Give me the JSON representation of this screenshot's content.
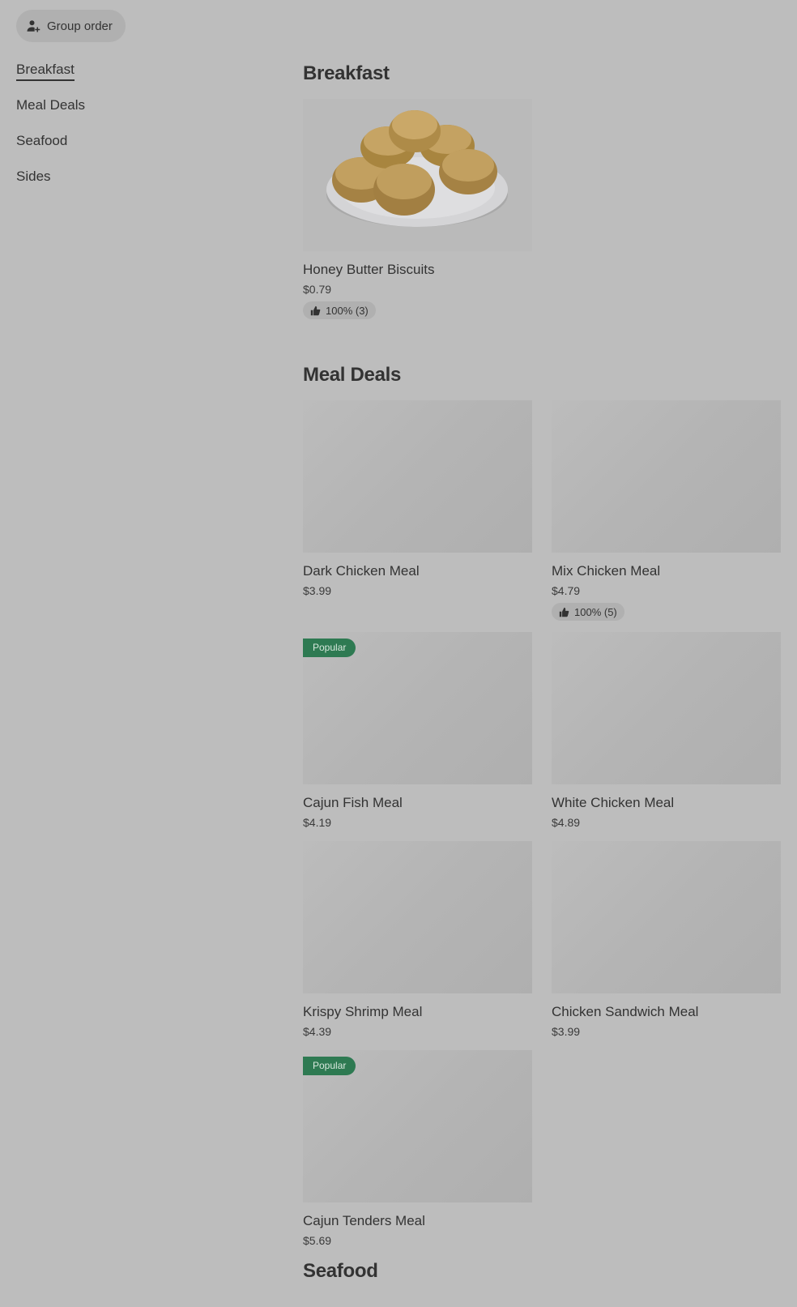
{
  "group_order": {
    "label": "Group order",
    "icon": "person-add-icon"
  },
  "sidebar": {
    "items": [
      {
        "label": "Breakfast",
        "active": true
      },
      {
        "label": "Meal Deals",
        "active": false
      },
      {
        "label": "Seafood",
        "active": false
      },
      {
        "label": "Sides",
        "active": false
      }
    ]
  },
  "sections": {
    "breakfast": {
      "title": "Breakfast",
      "items": [
        {
          "name": "Honey Butter Biscuits",
          "price": "$0.79",
          "rating": "100% (3)"
        }
      ]
    },
    "meal_deals": {
      "title": "Meal Deals",
      "items": [
        {
          "name": "Dark Chicken Meal",
          "price": "$3.99"
        },
        {
          "name": "Mix Chicken Meal",
          "price": "$4.79",
          "rating": "100% (5)"
        },
        {
          "name": "Cajun Fish Meal",
          "price": "$4.19",
          "badge": "Popular"
        },
        {
          "name": "White Chicken Meal",
          "price": "$4.89"
        },
        {
          "name": "Krispy Shrimp Meal",
          "price": "$4.39"
        },
        {
          "name": "Chicken Sandwich Meal",
          "price": "$3.99"
        },
        {
          "name": "Cajun Tenders Meal",
          "price": "$5.69",
          "badge": "Popular"
        }
      ]
    },
    "seafood": {
      "title": "Seafood"
    }
  },
  "colors": {
    "overlay": "#bdbdbd",
    "popular_badge": "#2e7a52"
  }
}
